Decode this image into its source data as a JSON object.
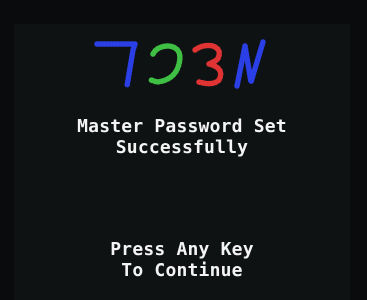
{
  "logo": {
    "icon": "device-logo-icon",
    "colors": [
      "#2b3fe6",
      "#3fbf43",
      "#e03434",
      "#2b3fe6"
    ]
  },
  "status": {
    "line1": "Master Password Set",
    "line2": "Successfully"
  },
  "prompt": {
    "line1": "Press Any Key",
    "line2": "To Continue"
  }
}
